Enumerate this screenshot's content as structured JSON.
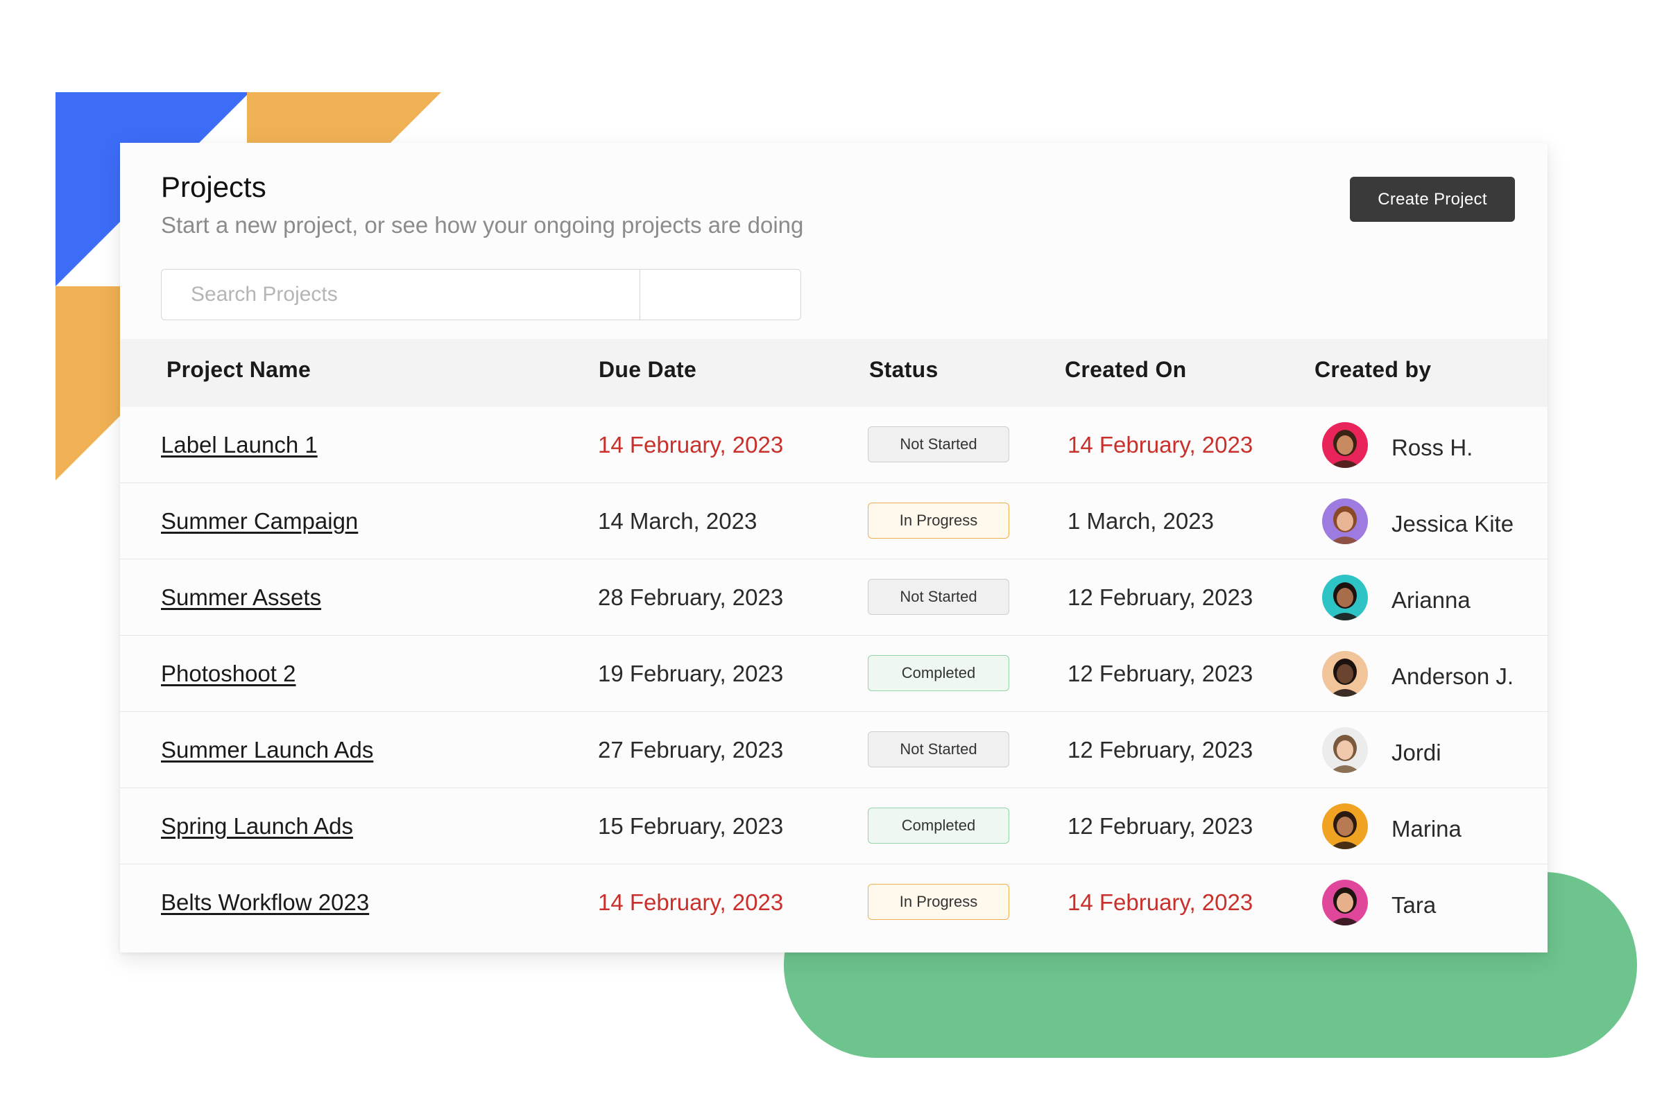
{
  "header": {
    "title": "Projects",
    "subtitle": "Start a new project, or see how your ongoing projects are doing",
    "create_button_label": "Create Project"
  },
  "search": {
    "placeholder": "Search Projects",
    "value": ""
  },
  "table": {
    "columns": [
      "Project Name",
      "Due Date",
      "Status",
      "Created On",
      "Created by"
    ],
    "rows": [
      {
        "name": "Label Launch 1",
        "due": "14 February, 2023",
        "due_overdue": true,
        "status": "Not Started",
        "created_on": "14 February, 2023",
        "created_overdue": true,
        "creator": "Ross H.",
        "avatar_bg": "#e8245a",
        "avatar_skin": "#c88a60",
        "avatar_hair": "#3a2315"
      },
      {
        "name": "Summer Campaign",
        "due": "14 March, 2023",
        "due_overdue": false,
        "status": "In Progress",
        "created_on": "1 March, 2023",
        "created_overdue": false,
        "creator": "Jessica Kite",
        "avatar_bg": "#9d7be0",
        "avatar_skin": "#e9b597",
        "avatar_hair": "#8a4a27"
      },
      {
        "name": "Summer Assets",
        "due": "28 February, 2023",
        "due_overdue": false,
        "status": "Not Started",
        "created_on": "12 February, 2023",
        "created_overdue": false,
        "creator": "Arianna",
        "avatar_bg": "#2ec4c6",
        "avatar_skin": "#a86e4c",
        "avatar_hair": "#1c1210"
      },
      {
        "name": "Photoshoot 2",
        "due": "19 February, 2023",
        "due_overdue": false,
        "status": "Completed",
        "created_on": "12 February, 2023",
        "created_overdue": false,
        "creator": "Anderson J.",
        "avatar_bg": "#f2c49a",
        "avatar_skin": "#6b4430",
        "avatar_hair": "#1b1210"
      },
      {
        "name": "Summer Launch Ads",
        "due": "27 February, 2023",
        "due_overdue": false,
        "status": "Not Started",
        "created_on": "12 February, 2023",
        "created_overdue": false,
        "creator": "Jordi",
        "avatar_bg": "#ececec",
        "avatar_skin": "#f0c8ad",
        "avatar_hair": "#7a5a3c"
      },
      {
        "name": "Spring Launch Ads",
        "due": "15 February, 2023",
        "due_overdue": false,
        "status": "Completed",
        "created_on": "12 February, 2023",
        "created_overdue": false,
        "creator": "Marina",
        "avatar_bg": "#f0a322",
        "avatar_skin": "#b87a52",
        "avatar_hair": "#2a1a10"
      },
      {
        "name": "Belts Workflow 2023",
        "due": "14 February, 2023",
        "due_overdue": true,
        "status": "In Progress",
        "created_on": "14 February, 2023",
        "created_overdue": true,
        "creator": "Tara",
        "avatar_bg": "#e0479a",
        "avatar_skin": "#e6b08c",
        "avatar_hair": "#1e1410"
      }
    ]
  },
  "colors": {
    "overdue": "#c9302c",
    "accent_blue": "#3d6cf7",
    "accent_orange": "#efb154",
    "accent_green": "#6dc48d",
    "button_dark": "#3a3a3a"
  }
}
